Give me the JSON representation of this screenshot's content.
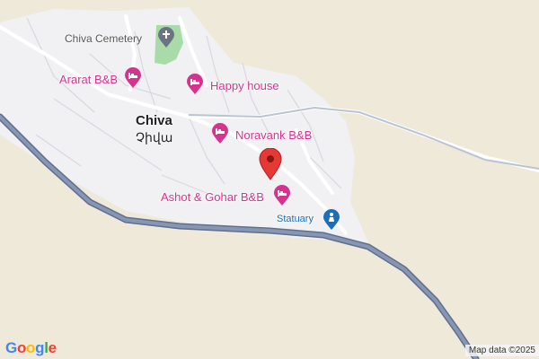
{
  "map": {
    "town": {
      "name": "Chiva",
      "native_name": "Չիվա"
    },
    "places": [
      {
        "id": "cemetery",
        "label": "Chiva Cemetery",
        "icon": "cemetery-icon"
      },
      {
        "id": "ararat",
        "label": "Ararat B&B",
        "icon": "hotel-icon"
      },
      {
        "id": "happy",
        "label": "Happy house",
        "icon": "hotel-icon"
      },
      {
        "id": "noravank",
        "label": "Noravank B&B",
        "icon": "hotel-icon"
      },
      {
        "id": "ashot",
        "label": "Ashot & Gohar B&B",
        "icon": "hotel-icon"
      },
      {
        "id": "statuary",
        "label": "Statuary",
        "icon": "statue-icon"
      }
    ],
    "marker": {
      "icon": "location-pin-icon",
      "color": "#e53935"
    },
    "colors": {
      "land": "#efe9da",
      "settlement": "#f1f1f3",
      "park": "#a8dba8",
      "highway": "#7b8aa6",
      "road": "#ffffff",
      "lodging": "#d6338e",
      "attraction": "#1a6fb5"
    }
  },
  "branding": {
    "logo": "Google",
    "attribution": "Map data ©2025"
  }
}
